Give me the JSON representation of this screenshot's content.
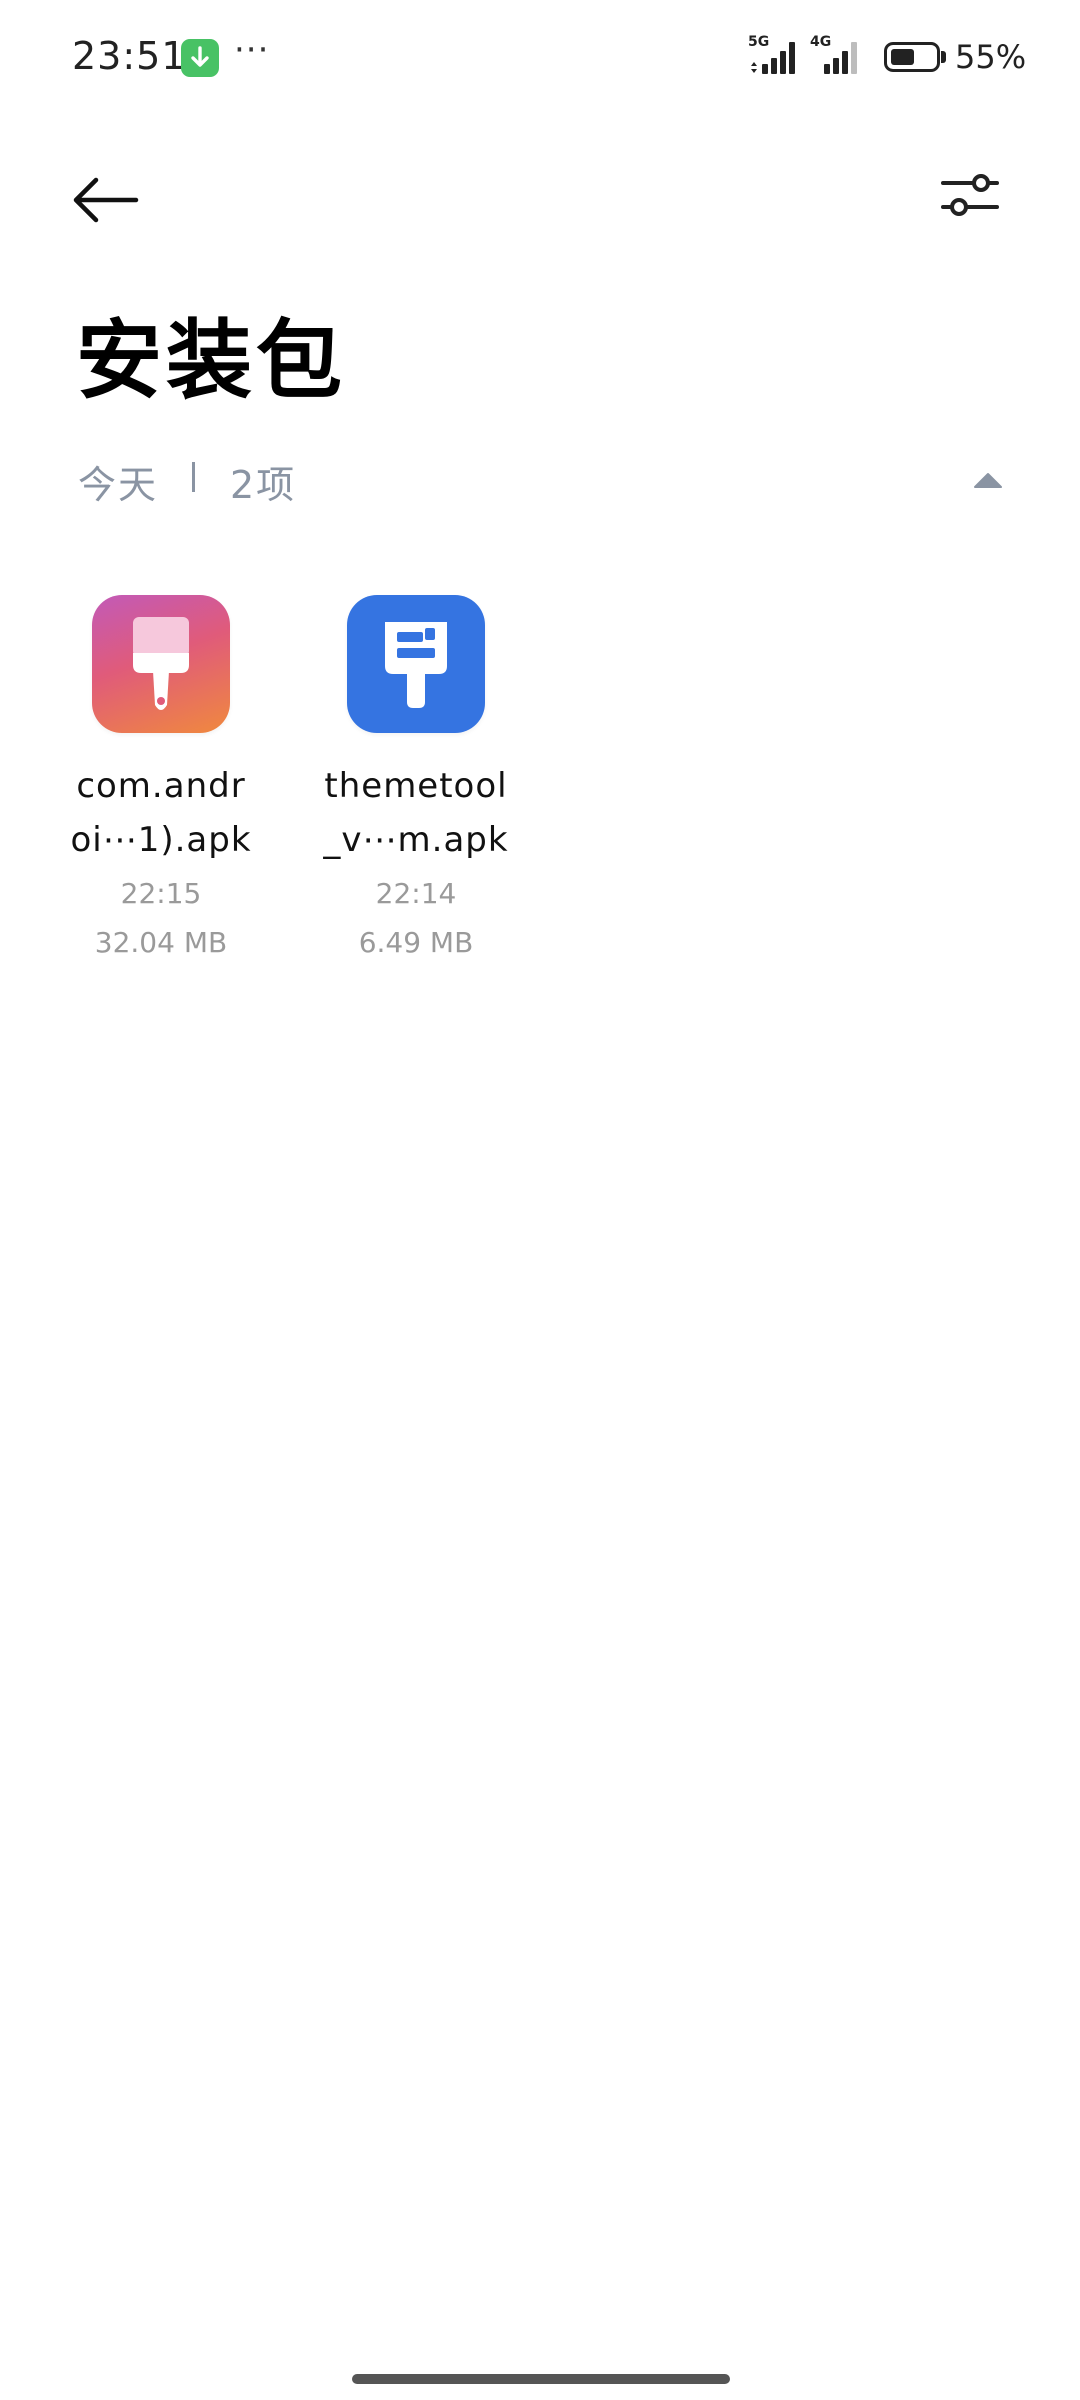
{
  "status_bar": {
    "time": "23:51",
    "more": "···",
    "network_1": "5G",
    "network_2": "4G",
    "battery_text": "55%",
    "battery_level": 0.55
  },
  "header": {
    "title": "安装包",
    "back_icon": "arrow-left-icon",
    "filter_icon": "sliders-icon"
  },
  "group": {
    "label": "今天",
    "count": "2项",
    "collapse_icon": "triangle-up-icon"
  },
  "files": [
    {
      "name_line1": "com.andr",
      "name_line2": "oi⋯1).apk",
      "time": "22:15",
      "size": "32.04 MB",
      "icon": "paintbrush-icon",
      "icon_colors": [
        "#c25ab8",
        "#e05b7a",
        "#f0893e"
      ]
    },
    {
      "name_line1": "themetool",
      "name_line2": "_v⋯m.apk",
      "time": "22:14",
      "size": "6.49 MB",
      "icon": "theme-brush-icon",
      "icon_colors": [
        "#3574e1"
      ]
    }
  ],
  "colors": {
    "accent_gray": "#8a94a3",
    "secondary_text": "#9a9a9a",
    "download_badge": "#48c265"
  }
}
